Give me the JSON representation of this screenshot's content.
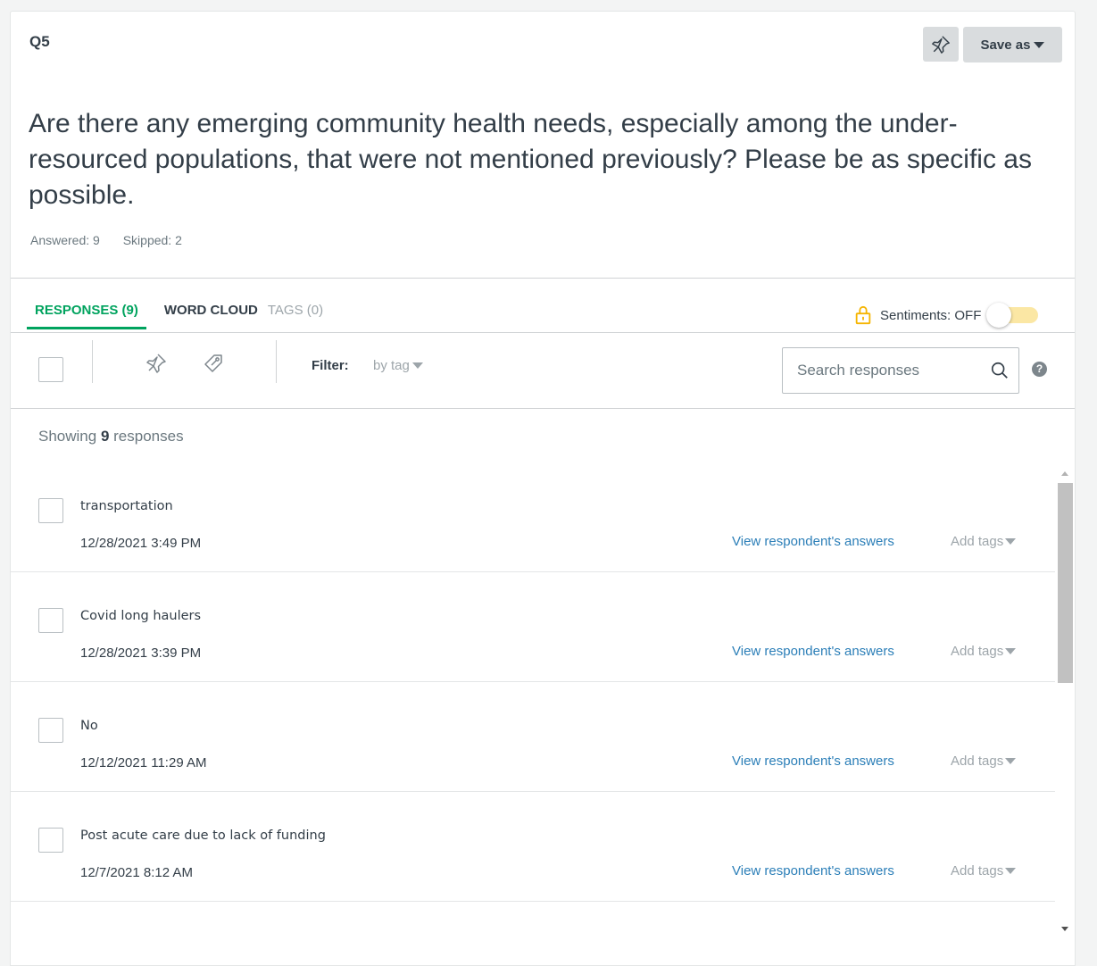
{
  "question": {
    "number": "Q5",
    "text": "Are there any emerging community health needs, especially among the under-resourced populations, that were not mentioned previously? Please be as specific as possible.",
    "answered": "Answered: 9",
    "skipped": "Skipped: 2"
  },
  "header": {
    "save_as_label": "Save as",
    "pin_icon": "pin-icon"
  },
  "tabs": [
    {
      "label": "RESPONSES (9)",
      "state": "active"
    },
    {
      "label": "WORD CLOUD",
      "state": "normal"
    },
    {
      "label": "TAGS (0)",
      "state": "disabled"
    }
  ],
  "sentiments": {
    "label": "Sentiments: OFF",
    "lock_icon": "lock-icon",
    "toggle_on": false
  },
  "toolbar": {
    "filter_label": "Filter:",
    "filter_value": "by tag",
    "search_placeholder": "Search responses",
    "help_label": "?"
  },
  "summary": {
    "prefix": "Showing ",
    "count": "9",
    "suffix": " responses"
  },
  "responses": [
    {
      "text": "transportation",
      "date": "12/28/2021 3:49 PM",
      "view_label": "View respondent's answers",
      "tags_label": "Add tags"
    },
    {
      "text": "Covid long haulers",
      "date": "12/28/2021 3:39 PM",
      "view_label": "View respondent's answers",
      "tags_label": "Add tags"
    },
    {
      "text": "No",
      "date": "12/12/2021 11:29 AM",
      "view_label": "View respondent's answers",
      "tags_label": "Add tags"
    },
    {
      "text": "Post acute care due to lack of funding",
      "date": "12/7/2021 8:12 AM",
      "view_label": "View respondent's answers",
      "tags_label": "Add tags"
    }
  ],
  "colors": {
    "accent_green": "#00a35e",
    "link_blue": "#2c7fb8",
    "lock_yellow": "#f5b400",
    "toggle_track": "#fbe7a4"
  }
}
